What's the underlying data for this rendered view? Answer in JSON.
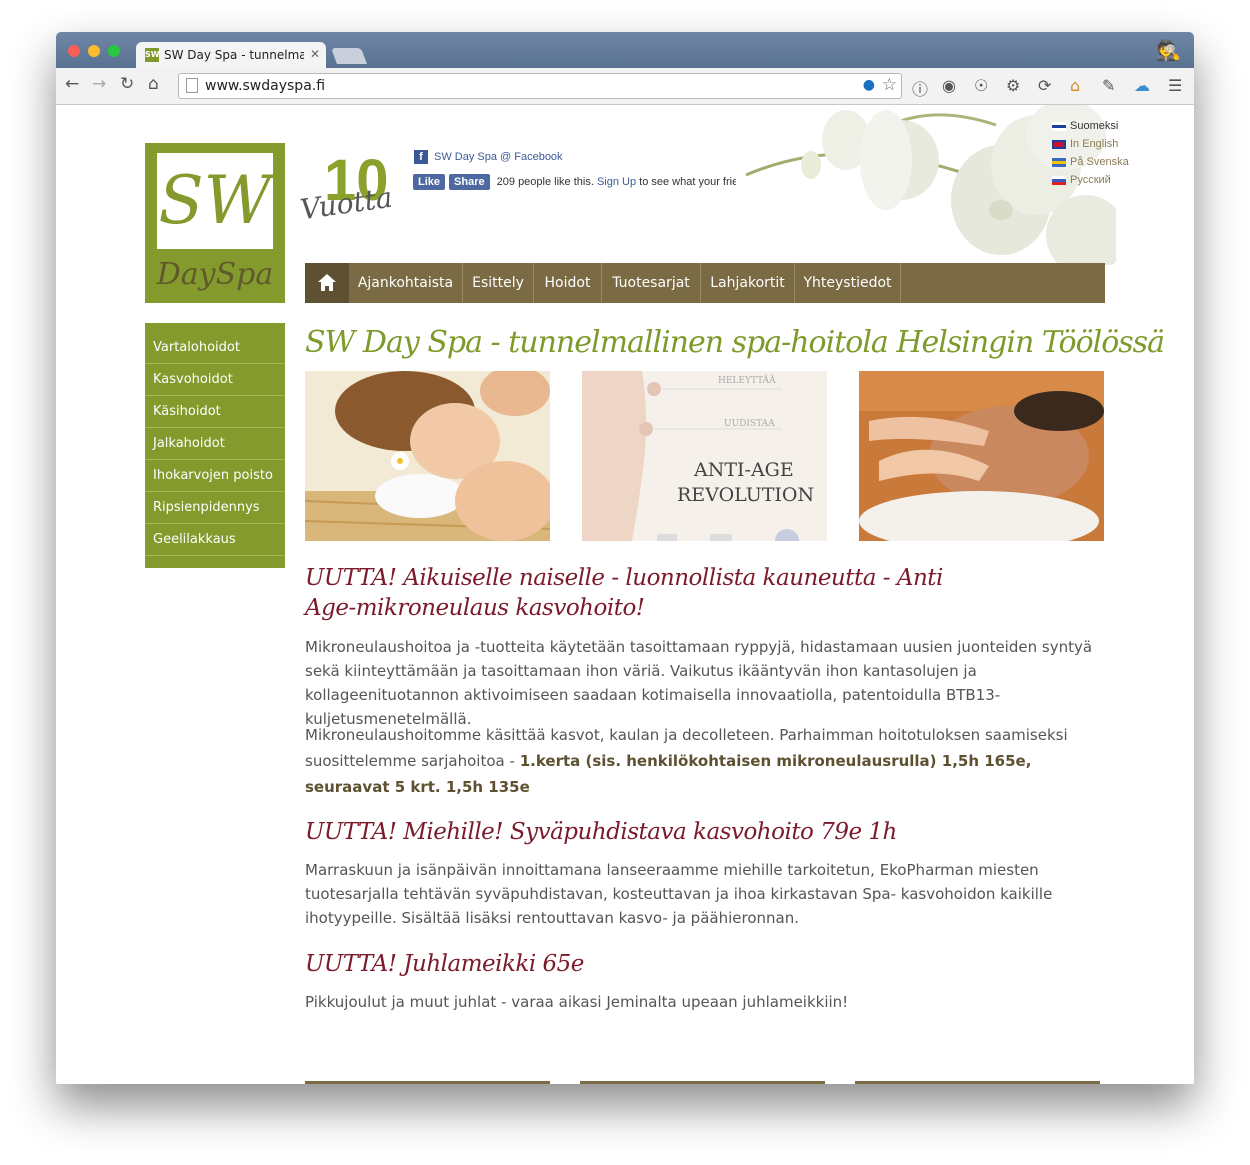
{
  "browser": {
    "tab_title": "SW Day Spa - tunnelmallinen",
    "tab_favicon": "SW",
    "tab_close": "✕",
    "url": "www.swdayspa.fi"
  },
  "header": {
    "logo_top": "SW",
    "logo_bottom": "DaySpa",
    "anniversary_number": "10",
    "anniversary_word": "Vuotta",
    "facebook_link": "SW Day Spa @ Facebook",
    "like_button": "Like",
    "share_button": "Share",
    "likes_text": "209 people like this.",
    "signup_link": "Sign Up",
    "signup_suffix": "to see what your friends like.",
    "languages": [
      {
        "label": "Suomeksi"
      },
      {
        "label": "In English"
      },
      {
        "label": "På Svenska"
      },
      {
        "label": "Русский"
      }
    ]
  },
  "menu": {
    "home_icon": "home-icon",
    "items": [
      {
        "label": "Ajankohtaista"
      },
      {
        "label": "Esittely"
      },
      {
        "label": "Hoidot"
      },
      {
        "label": "Tuotesarjat"
      },
      {
        "label": "Lahjakortit"
      },
      {
        "label": "Yhteystiedot"
      }
    ]
  },
  "sidebar": {
    "items": [
      {
        "label": "Vartalohoidot"
      },
      {
        "label": "Kasvohoidot"
      },
      {
        "label": "Käsihoidot"
      },
      {
        "label": "Jalkahoidot"
      },
      {
        "label": "Ihokarvojen poisto"
      },
      {
        "label": "Ripsienpidennys"
      },
      {
        "label": "Geelilakkaus"
      }
    ]
  },
  "main": {
    "title": "SW Day Spa - tunnelmallinen spa-hoitola Helsingin Töölössä",
    "image2": {
      "label_top": "HELEYTTÄÄ",
      "label_mid": "UUDISTAA",
      "headline1": "ANTI-AGE",
      "headline2": "REVOLUTION"
    },
    "section1_title": "UUTTA! Aikuiselle naiselle - luonnollista kauneutta - Anti Age-mikroneulaus kasvohoito!",
    "section1_p1": "Mikroneulaushoitoa ja -tuotteita käytetään tasoittamaan ryppyjä, hidastamaan uusien juonteiden syntyä sekä kiinteyttämään ja tasoittamaan ihon väriä. Vaikutus ikääntyvän ihon kantasolujen ja kollageenituotannon aktivoimiseen saadaan kotimaisella innovaatiolla, patentoidulla BTB13-kuljetusmenetelmällä.",
    "section1_p2_text": "Mikroneulaushoitomme käsittää kasvot, kaulan ja decolleteen. Parhaimman hoitotuloksen saamiseksi suosittelemme sarjahoitoa - ",
    "section1_p2_bold": "1.kerta (sis. henkilökohtaisen mikroneulausrulla) 1,5h 165e, seuraavat 5 krt. 1,5h 135e",
    "section2_title": "UUTTA! Miehille! Syväpuhdistava kasvohoito 79e 1h",
    "section2_p": "Marraskuun ja isänpäivän innoittamana lanseeraamme miehille tarkoitetun, EkoPharman miesten tuotesarjalla tehtävän syväpuhdistavan, kosteuttavan ja ihoa kirkastavan Spa- kasvohoidon kaikille ihotyypeille. Sisältää lisäksi rentouttavan kasvo- ja päähieronnan.",
    "section3_title": "UUTTA! Juhlameikki 65e",
    "section3_p": "Pikkujoulut ja muut juhlat -  varaa aikasi Jeminalta upeaan juhlameikkiin!"
  },
  "colors": {
    "brand_green": "#849a2c",
    "menu_brown": "#7b6b45",
    "heading_red": "#7a1a2a"
  }
}
